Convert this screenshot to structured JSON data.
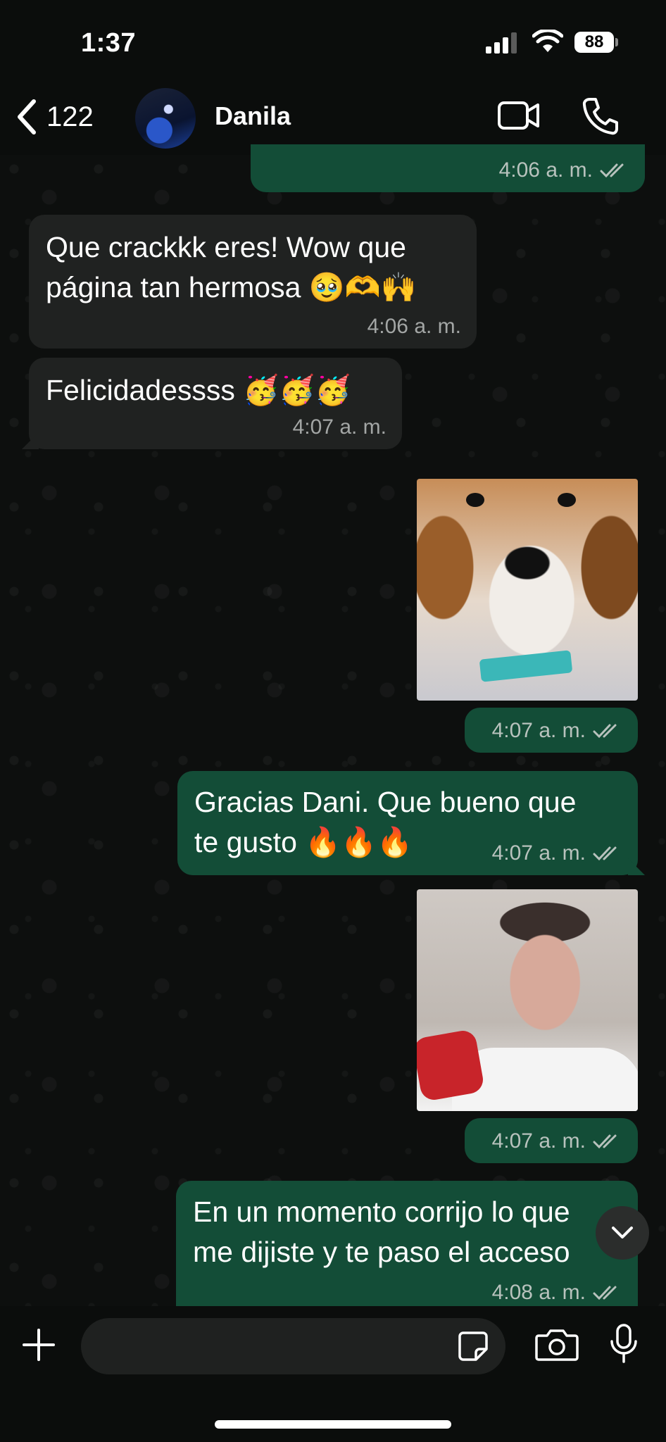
{
  "status_bar": {
    "time": "1:37",
    "battery": "88"
  },
  "header": {
    "back_count": "122",
    "contact_name": "Danila"
  },
  "messages": [
    {
      "id": "m0",
      "direction": "out",
      "time": "4:06 a. m."
    },
    {
      "id": "m1",
      "direction": "in",
      "lines": [
        "Que crackkk eres! Wow que",
        "página tan hermosa 🥹🫶🙌"
      ],
      "time": "4:06 a. m."
    },
    {
      "id": "m2",
      "direction": "in",
      "lines": [
        "Felicidadessss 🥳🥳🥳"
      ],
      "time": "4:07 a. m."
    },
    {
      "id": "m3",
      "direction": "out",
      "type": "sticker",
      "time": "4:07 a. m."
    },
    {
      "id": "m4",
      "direction": "out",
      "lines": [
        "Gracias Dani. Que bueno que",
        "te gusto 🔥🔥🔥"
      ],
      "time": "4:07 a. m."
    },
    {
      "id": "m5",
      "direction": "out",
      "type": "sticker",
      "time": "4:07 a. m."
    },
    {
      "id": "m6",
      "direction": "out",
      "lines": [
        "En un momento corrijo lo que",
        "me dijiste y te paso el acceso"
      ],
      "time": "4:08 a. m."
    }
  ],
  "composer": {
    "placeholder": ""
  },
  "colors": {
    "outgoing_bubble": "#134d37",
    "incoming_bubble": "#202221",
    "background": "#0b0d0c"
  }
}
